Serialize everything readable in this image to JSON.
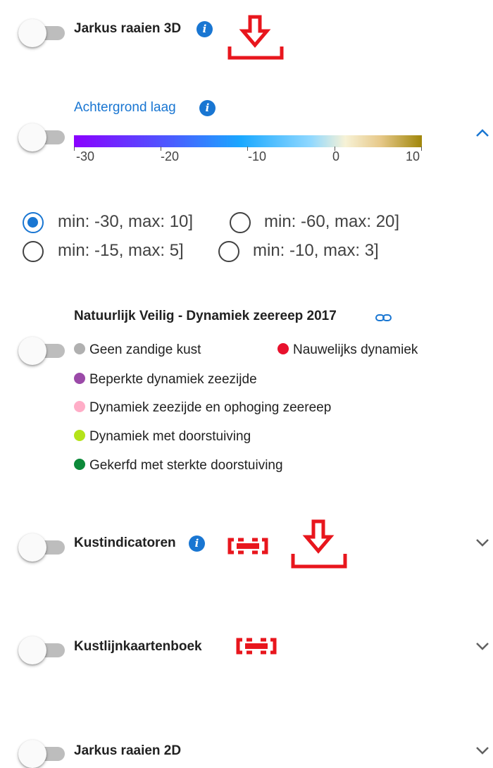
{
  "layers": [
    {
      "title": "Jarkus raaien 3D"
    },
    {
      "title": "Achtergrond laag"
    },
    {
      "title": "Natuurlijk Veilig - Dynamiek zeereep 2017"
    },
    {
      "title": "Kustindicatoren"
    },
    {
      "title": "Kustlijnkaartenboek"
    },
    {
      "title": "Jarkus raaien 2D"
    }
  ],
  "gradient": {
    "ticks": [
      "-30",
      "-20",
      "-10",
      "0",
      "10"
    ],
    "colors": [
      "#8a00ff",
      "#1aa8ff",
      "#f7f2d6",
      "#a0860a"
    ]
  },
  "range_options": [
    {
      "label": "min: -30, max: 10]",
      "selected": true
    },
    {
      "label": "min: -60, max: 20]",
      "selected": false
    },
    {
      "label": "min: -15, max: 5]",
      "selected": false
    },
    {
      "label": "min: -10, max: 3]",
      "selected": false
    }
  ],
  "dynamiek_legend": [
    {
      "label": "Geen zandige kust",
      "color": "#b0b0b0"
    },
    {
      "label": "Nauwelijks dynamiek",
      "color": "#e8112d"
    },
    {
      "label": "Beperkte dynamiek zeezijde",
      "color": "#9b4aa8"
    },
    {
      "label": "Dynamiek zeezijde en ophoging zeereep",
      "color": "#ffadc7"
    },
    {
      "label": "Dynamiek met doorstuiving",
      "color": "#b4e319"
    },
    {
      "label": "Gekerfd met sterkte doorstuiving",
      "color": "#0c8a3a"
    }
  ],
  "colors": {
    "accent": "#1976d2",
    "annotation": "#e8161d"
  },
  "icons": {
    "info": "i",
    "link": "link-icon",
    "download": "download-icon",
    "chevron_up": "chevron-up-icon",
    "chevron_down": "chevron-down-icon"
  }
}
